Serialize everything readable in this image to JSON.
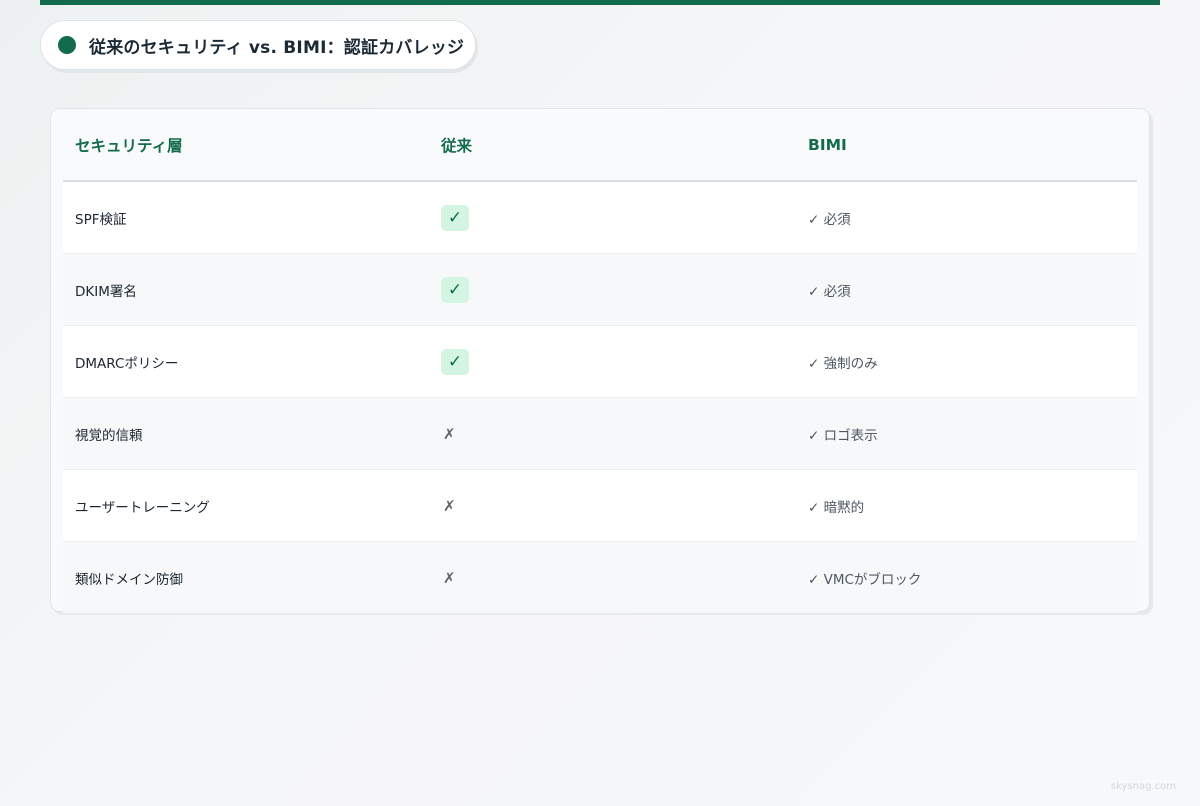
{
  "title": "従来のセキュリティ vs. BIMI：認証カバレッジ",
  "table": {
    "headers": [
      "セキュリティ層",
      "従来",
      "BIMI"
    ],
    "rows": [
      {
        "layer": "SPF検証",
        "traditional": "✓",
        "traditional_status": "check",
        "bimi": "✓ 必須"
      },
      {
        "layer": "DKIM署名",
        "traditional": "✓",
        "traditional_status": "check",
        "bimi": "✓ 必須"
      },
      {
        "layer": "DMARCポリシー",
        "traditional": "✓",
        "traditional_status": "check",
        "bimi": "✓ 強制のみ"
      },
      {
        "layer": "視覚的信頼",
        "traditional": "✗",
        "traditional_status": "cross",
        "bimi": "✓ ロゴ表示"
      },
      {
        "layer": "ユーザートレーニング",
        "traditional": "✗",
        "traditional_status": "cross",
        "bimi": "✓ 暗黙的"
      },
      {
        "layer": "類似ドメイン防御",
        "traditional": "✗",
        "traditional_status": "cross",
        "bimi": "✓ VMCがブロック"
      }
    ]
  },
  "watermark": "skysnag.com",
  "colors": {
    "accent": "#136b4d",
    "check_bg": "#d4f5e2"
  }
}
